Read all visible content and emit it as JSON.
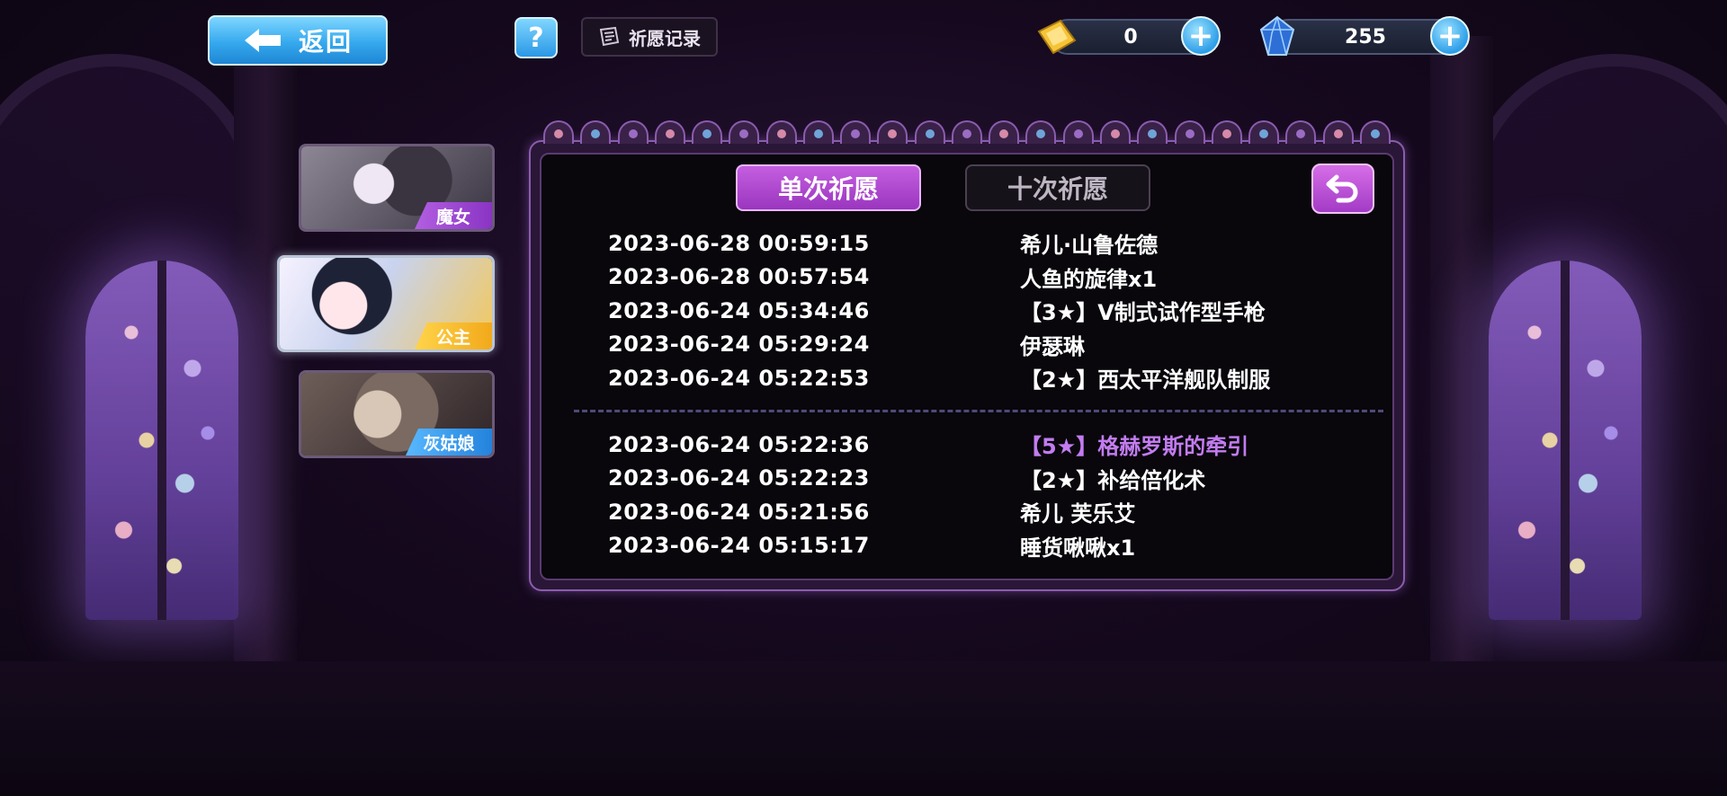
{
  "header": {
    "back_label": "返回",
    "help_label": "?",
    "record_label": "祈愿记录"
  },
  "currencies": [
    {
      "icon": "gold-ticket-icon",
      "value": "0"
    },
    {
      "icon": "blue-crystal-icon",
      "value": "255"
    }
  ],
  "characters": [
    {
      "name": "魔女",
      "badge_color": "#a94ad8",
      "selected": false
    },
    {
      "name": "公主",
      "badge_color": "#f6b92c",
      "selected": true
    },
    {
      "name": "灰姑娘",
      "badge_color": "#3a9cf0",
      "selected": false
    }
  ],
  "tabs": {
    "single": "单次祈愿",
    "ten": "十次祈愿",
    "active": "single"
  },
  "records_group1": [
    {
      "time": "2023-06-28 00:59:15",
      "item": "希儿·山鲁佐德"
    },
    {
      "time": "2023-06-28 00:57:54",
      "item": "人鱼的旋律x1"
    },
    {
      "time": "2023-06-24 05:34:46",
      "item": "【3★】V制式试作型手枪"
    },
    {
      "time": "2023-06-24 05:29:24",
      "item": "伊瑟琳"
    },
    {
      "time": "2023-06-24 05:22:53",
      "item": "【2★】西太平洋舰队制服"
    }
  ],
  "records_group2": [
    {
      "time": "2023-06-24 05:22:36",
      "item": "【5★】格赫罗斯的牵引",
      "rare": true
    },
    {
      "time": "2023-06-24 05:22:23",
      "item": "【2★】补给倍化术"
    },
    {
      "time": "2023-06-24 05:21:56",
      "item": "希儿 芙乐艾"
    },
    {
      "time": "2023-06-24 05:15:17",
      "item": "睡货啾啾x1"
    }
  ],
  "colors": {
    "accent_purple": "#b54bd6",
    "rare_text": "#c27cf0",
    "button_blue": "#35a9ee"
  }
}
